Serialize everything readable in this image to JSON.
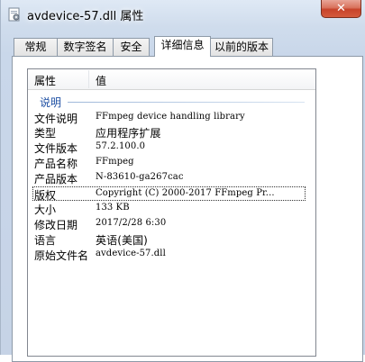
{
  "window": {
    "title": "avdevice-57.dll 属性",
    "close_glyph": "✕"
  },
  "tabs": [
    {
      "label": "常规",
      "active": false
    },
    {
      "label": "数字签名",
      "active": false
    },
    {
      "label": "安全",
      "active": false
    },
    {
      "label": "详细信息",
      "active": true
    },
    {
      "label": "以前的版本",
      "active": false
    }
  ],
  "details": {
    "columns": {
      "property": "属性",
      "value": "值"
    },
    "group": "说明",
    "rows": [
      {
        "name": "文件说明",
        "value": "FFmpeg device handling library"
      },
      {
        "name": "类型",
        "value": "应用程序扩展"
      },
      {
        "name": "文件版本",
        "value": "57.2.100.0"
      },
      {
        "name": "产品名称",
        "value": "FFmpeg"
      },
      {
        "name": "产品版本",
        "value": "N-83610-ga267cac"
      },
      {
        "name": "版权",
        "value": "Copyright (C) 2000-2017 FFmpeg Pr..."
      },
      {
        "name": "大小",
        "value": "133 KB"
      },
      {
        "name": "修改日期",
        "value": "2017/2/28 6:30"
      },
      {
        "name": "语言",
        "value": "英语(美国)"
      },
      {
        "name": "原始文件名",
        "value": "avdevice-57.dll"
      }
    ]
  }
}
